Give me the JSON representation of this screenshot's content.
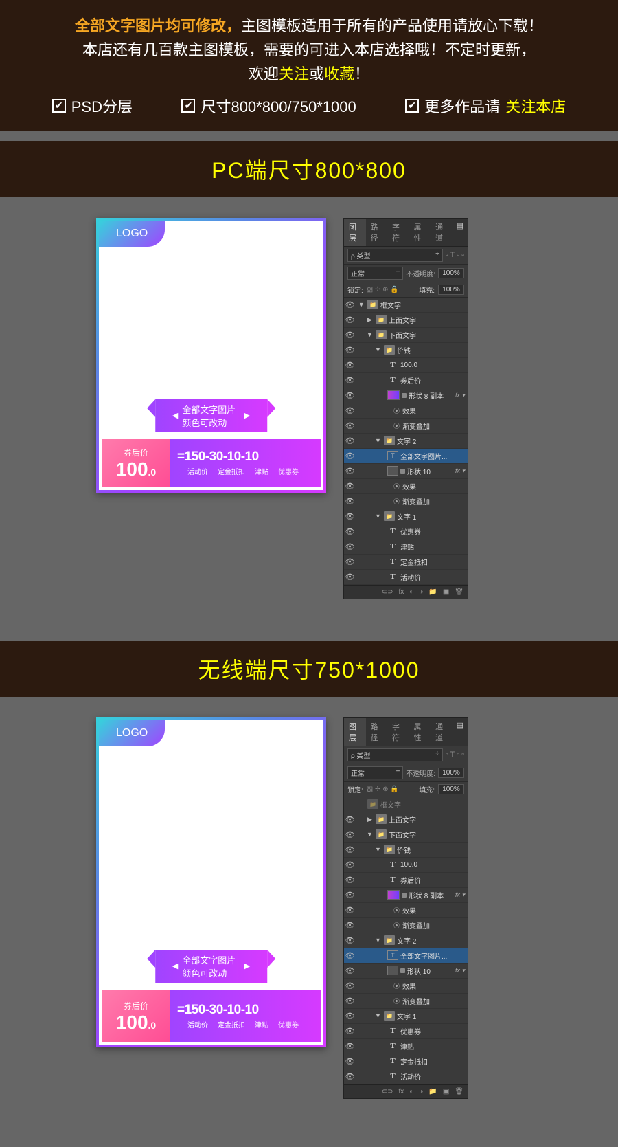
{
  "banner": {
    "line1_hl": "全部文字图片均可修改，",
    "line1": "主图模板适用于所有的产品使用请放心下载！",
    "line2": "本店还有几百款主图模板，需要的可进入本店选择哦！不定时更新，",
    "line3a": "欢迎",
    "line3b": "关注",
    "line3c": "或",
    "line3d": "收藏",
    "line3e": "！",
    "checks": {
      "c1": "PSD分层",
      "c2": "尺寸800*800/750*1000",
      "c3a": "更多作品请",
      "c3b": "关注本店"
    }
  },
  "section1_title": "PC端尺寸800*800",
  "section2_title": "无线端尺寸750*1000",
  "card": {
    "logo": "LOGO",
    "ribbon": "全部文字图片颜色可改动",
    "coupon_label": "券后价",
    "price_int": "100",
    "price_dec": ".0",
    "math": "=150-30-10-10",
    "sub1": "活动价",
    "sub2": "定金抵扣",
    "sub3": "津贴",
    "sub4": "优惠券"
  },
  "ps": {
    "tabs": {
      "t1": "图层",
      "t2": "路径",
      "t3": "字符",
      "t4": "属性",
      "t5": "通道"
    },
    "kind": "ρ 类型",
    "blend": "正常",
    "opacity_lbl": "不透明度:",
    "opacity_val": "100%",
    "lock_lbl": "锁定:",
    "fill_lbl": "填充:",
    "fill_val": "100%",
    "layers": {
      "frame": "框文字",
      "top_text": "上面文字",
      "bottom_text": "下面文字",
      "price_group": "价钱",
      "l_100": "100.0",
      "l_coupon": "券后价",
      "l_shape8": "形状 8 副本",
      "l_fx": "效果",
      "l_overlay": "渐变叠加",
      "l_text2": "文字 2",
      "l_alltext": "全部文字图片...",
      "l_shape10": "形状 10",
      "l_text1": "文字 1",
      "l_youhuiquan": "优惠券",
      "l_jintie": "津贴",
      "l_dingjin": "定金抵扣",
      "l_huodong": "活动价"
    }
  }
}
